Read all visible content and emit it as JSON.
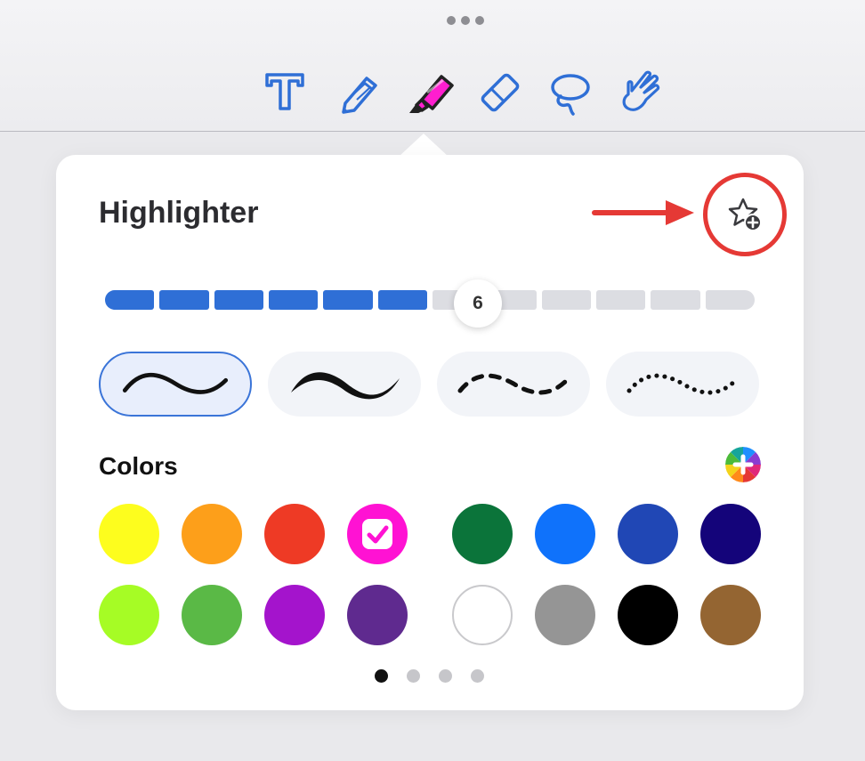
{
  "toolbar": {
    "tools": [
      {
        "name": "text-tool",
        "icon": "text-icon"
      },
      {
        "name": "pen-tool",
        "icon": "pen-icon"
      },
      {
        "name": "highlighter-tool",
        "icon": "highlighter-icon",
        "selected": true
      },
      {
        "name": "eraser-tool",
        "icon": "eraser-icon"
      },
      {
        "name": "lasso-tool",
        "icon": "lasso-icon"
      },
      {
        "name": "hand-tool",
        "icon": "hand-icon"
      }
    ],
    "accent_color": "#2f6fd6",
    "highlighter_color": "#ff1ecf"
  },
  "panel": {
    "title": "Highlighter",
    "favorite_icon": "star-plus-icon",
    "annotation_color": "#e53935"
  },
  "size_slider": {
    "value": "6",
    "segments": 12,
    "filled_segments": 6,
    "fill_color": "#2f6fd6",
    "track_color": "#dcdde2"
  },
  "stroke_styles": [
    {
      "name": "thin-solid",
      "selected": true
    },
    {
      "name": "calligraphy",
      "selected": false
    },
    {
      "name": "dashed",
      "selected": false
    },
    {
      "name": "dotted",
      "selected": false
    }
  ],
  "colors": {
    "label": "Colors",
    "add_icon": "color-wheel-plus-icon",
    "swatches": [
      {
        "hex": "#fdfd1e",
        "selected": false
      },
      {
        "hex": "#fd9f1a",
        "selected": false
      },
      {
        "hex": "#ee3a25",
        "selected": false
      },
      {
        "hex": "#ff12d3",
        "selected": true
      },
      {
        "hex": "#0b743a",
        "selected": false
      },
      {
        "hex": "#0f72fb",
        "selected": false
      },
      {
        "hex": "#2047b5",
        "selected": false
      },
      {
        "hex": "#14047a",
        "selected": false
      },
      {
        "hex": "#a6fc25",
        "selected": false
      },
      {
        "hex": "#5ab946",
        "selected": false
      },
      {
        "hex": "#a414cc",
        "selected": false
      },
      {
        "hex": "#5f2a8f",
        "selected": false
      },
      {
        "hex": "#ffffff",
        "selected": false
      },
      {
        "hex": "#959595",
        "selected": false
      },
      {
        "hex": "#000000",
        "selected": false
      },
      {
        "hex": "#946532",
        "selected": false
      }
    ]
  },
  "pager": {
    "count": 4,
    "active": 0
  }
}
